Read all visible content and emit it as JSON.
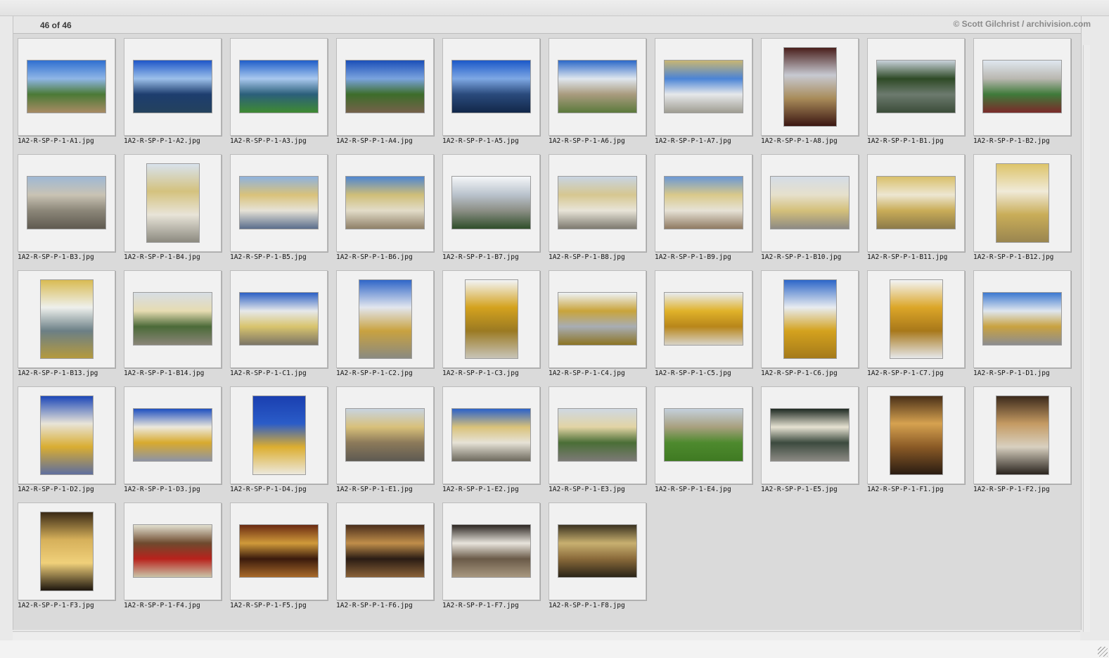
{
  "header": {
    "count_text": "46 of 46",
    "credit_text": "© Scott Gilchrist / archivision.com"
  },
  "thumbnails": [
    {
      "filename": "1A2-R-SP-P-1-A1.jpg",
      "orientation": "landscape",
      "colors": [
        "#2f6fd0",
        "#8fb6e6",
        "#4b7a36",
        "#a88a64"
      ]
    },
    {
      "filename": "1A2-R-SP-P-1-A2.jpg",
      "orientation": "landscape",
      "colors": [
        "#1e56c8",
        "#9cc0ea",
        "#1d3d6e",
        "#24425e"
      ]
    },
    {
      "filename": "1A2-R-SP-P-1-A3.jpg",
      "orientation": "landscape",
      "colors": [
        "#1f5ec9",
        "#a9c8ee",
        "#2b5f7a",
        "#3f8a32"
      ]
    },
    {
      "filename": "1A2-R-SP-P-1-A4.jpg",
      "orientation": "landscape",
      "colors": [
        "#1b4fb8",
        "#7aa3de",
        "#3d6d2a",
        "#75614a"
      ]
    },
    {
      "filename": "1A2-R-SP-P-1-A5.jpg",
      "orientation": "landscape",
      "colors": [
        "#1b58c8",
        "#7ea8e4",
        "#2a4a7c",
        "#12284a"
      ]
    },
    {
      "filename": "1A2-R-SP-P-1-A6.jpg",
      "orientation": "landscape",
      "colors": [
        "#2c68c8",
        "#dfe6ee",
        "#a99b7e",
        "#5b7a3c"
      ]
    },
    {
      "filename": "1A2-R-SP-P-1-A7.jpg",
      "orientation": "landscape",
      "colors": [
        "#c9b673",
        "#4b84d6",
        "#e6e8ea",
        "#9f9d92"
      ]
    },
    {
      "filename": "1A2-R-SP-P-1-A8.jpg",
      "orientation": "portrait",
      "colors": [
        "#4a1f1c",
        "#c7c9d1",
        "#a88b59",
        "#3b1612"
      ]
    },
    {
      "filename": "1A2-R-SP-P-1-B1.jpg",
      "orientation": "landscape",
      "colors": [
        "#c8d2da",
        "#2e4a26",
        "#6c7a6e",
        "#3c4d3a"
      ]
    },
    {
      "filename": "1A2-R-SP-P-1-B2.jpg",
      "orientation": "landscape",
      "colors": [
        "#dfe7ef",
        "#b9b7b0",
        "#3f7a3a",
        "#7b2a2a"
      ]
    },
    {
      "filename": "1A2-R-SP-P-1-B3.jpg",
      "orientation": "landscape",
      "colors": [
        "#9fb8d4",
        "#c9c3b4",
        "#8c8779",
        "#5f5a50"
      ]
    },
    {
      "filename": "1A2-R-SP-P-1-B4.jpg",
      "orientation": "portrait",
      "colors": [
        "#d8e2ec",
        "#d4c27e",
        "#e8e4d8",
        "#8c8a80"
      ]
    },
    {
      "filename": "1A2-R-SP-P-1-B5.jpg",
      "orientation": "landscape",
      "colors": [
        "#8fb2de",
        "#d9c27a",
        "#e6e2d6",
        "#5a6e8c"
      ]
    },
    {
      "filename": "1A2-R-SP-P-1-B6.jpg",
      "orientation": "landscape",
      "colors": [
        "#4f86d0",
        "#cfbe78",
        "#e2dcc8",
        "#8f8068"
      ]
    },
    {
      "filename": "1A2-R-SP-P-1-B7.jpg",
      "orientation": "landscape",
      "colors": [
        "#f4f6f8",
        "#b9c2cc",
        "#8c8f86",
        "#2f4e2a"
      ]
    },
    {
      "filename": "1A2-R-SP-P-1-B8.jpg",
      "orientation": "landscape",
      "colors": [
        "#c8d4e2",
        "#d6c790",
        "#e8e4d8",
        "#7d7a70"
      ]
    },
    {
      "filename": "1A2-R-SP-P-1-B9.jpg",
      "orientation": "landscape",
      "colors": [
        "#6b98d4",
        "#d9c98a",
        "#e6e2d6",
        "#8f7a62"
      ]
    },
    {
      "filename": "1A2-R-SP-P-1-B10.jpg",
      "orientation": "landscape",
      "colors": [
        "#d4dce6",
        "#e6e0cc",
        "#d4c07a",
        "#8d8a84"
      ]
    },
    {
      "filename": "1A2-R-SP-P-1-B11.jpg",
      "orientation": "landscape",
      "colors": [
        "#d9c06a",
        "#ede6d2",
        "#c9ad58",
        "#8c7a4a"
      ]
    },
    {
      "filename": "1A2-R-SP-P-1-B12.jpg",
      "orientation": "portrait",
      "colors": [
        "#ddc46a",
        "#f0ead8",
        "#c9ad58",
        "#9a8650"
      ]
    },
    {
      "filename": "1A2-R-SP-P-1-B13.jpg",
      "orientation": "portrait",
      "colors": [
        "#d9bb52",
        "#eef0ec",
        "#6b7f86",
        "#b59a3e"
      ]
    },
    {
      "filename": "1A2-R-SP-P-1-B14.jpg",
      "orientation": "landscape",
      "colors": [
        "#d7dde4",
        "#e6dcb2",
        "#4b6a38",
        "#8a8578"
      ]
    },
    {
      "filename": "1A2-R-SP-P-1-C1.jpg",
      "orientation": "landscape",
      "colors": [
        "#2b5fc4",
        "#e6e8ea",
        "#d8c46e",
        "#7c7566"
      ]
    },
    {
      "filename": "1A2-R-SP-P-1-C2.jpg",
      "orientation": "portrait",
      "colors": [
        "#2f66c8",
        "#e2e6ee",
        "#c9a240",
        "#8a8a80"
      ]
    },
    {
      "filename": "1A2-R-SP-P-1-C3.jpg",
      "orientation": "portrait",
      "colors": [
        "#f2f4f6",
        "#d4a21e",
        "#9b7a22",
        "#c8c4b8"
      ]
    },
    {
      "filename": "1A2-R-SP-P-1-C4.jpg",
      "orientation": "landscape",
      "colors": [
        "#eef2f6",
        "#c9a43a",
        "#a8adb4",
        "#8c7424"
      ]
    },
    {
      "filename": "1A2-R-SP-P-1-C5.jpg",
      "orientation": "landscape",
      "colors": [
        "#e8ecf0",
        "#e0b22a",
        "#b8861a",
        "#d8d4c8"
      ]
    },
    {
      "filename": "1A2-R-SP-P-1-C6.jpg",
      "orientation": "portrait",
      "colors": [
        "#2c66c8",
        "#e8ecf0",
        "#d4a21e",
        "#a57a1a"
      ]
    },
    {
      "filename": "1A2-R-SP-P-1-C7.jpg",
      "orientation": "portrait",
      "colors": [
        "#f2f4f6",
        "#dca628",
        "#a8781a",
        "#e6e8ea"
      ]
    },
    {
      "filename": "1A2-R-SP-P-1-D1.jpg",
      "orientation": "landscape",
      "colors": [
        "#3c78d0",
        "#dfe6ee",
        "#c9a240",
        "#8c8d90"
      ]
    },
    {
      "filename": "1A2-R-SP-P-1-D2.jpg",
      "orientation": "portrait",
      "colors": [
        "#1c47b8",
        "#e8e4d8",
        "#d9ad32",
        "#5e6e9e"
      ]
    },
    {
      "filename": "1A2-R-SP-P-1-D3.jpg",
      "orientation": "landscape",
      "colors": [
        "#1e4fc0",
        "#ece8dc",
        "#d8aa2e",
        "#8e94a4"
      ]
    },
    {
      "filename": "1A2-R-SP-P-1-D4.jpg",
      "orientation": "portrait",
      "colors": [
        "#1a3fb0",
        "#2a5cc8",
        "#dcae30",
        "#ece8dc"
      ]
    },
    {
      "filename": "1A2-R-SP-P-1-E1.jpg",
      "orientation": "landscape",
      "colors": [
        "#c8d4e0",
        "#d8c07a",
        "#8c7a5a",
        "#5e5a52"
      ]
    },
    {
      "filename": "1A2-R-SP-P-1-E2.jpg",
      "orientation": "landscape",
      "colors": [
        "#2c62c8",
        "#d9c27a",
        "#e6e2d6",
        "#6e6a5e"
      ]
    },
    {
      "filename": "1A2-R-SP-P-1-E3.jpg",
      "orientation": "landscape",
      "colors": [
        "#cfd8e2",
        "#e2d4a4",
        "#4a6e36",
        "#7c7a76"
      ]
    },
    {
      "filename": "1A2-R-SP-P-1-E4.jpg",
      "orientation": "landscape",
      "colors": [
        "#c4d0dc",
        "#a8a07e",
        "#4e8a2e",
        "#3f7a22"
      ]
    },
    {
      "filename": "1A2-R-SP-P-1-E5.jpg",
      "orientation": "landscape",
      "colors": [
        "#1e2a22",
        "#e6e2d2",
        "#3c4a3e",
        "#8c8a84"
      ]
    },
    {
      "filename": "1A2-R-SP-P-1-F1.jpg",
      "orientation": "portrait",
      "colors": [
        "#4a3018",
        "#d6a250",
        "#8a5a26",
        "#2a1c12"
      ]
    },
    {
      "filename": "1A2-R-SP-P-1-F2.jpg",
      "orientation": "portrait",
      "colors": [
        "#3c2a1c",
        "#c49a62",
        "#d8d0c0",
        "#2a241e"
      ]
    },
    {
      "filename": "1A2-R-SP-P-1-F3.jpg",
      "orientation": "portrait",
      "colors": [
        "#3a2a16",
        "#d6b05a",
        "#f0d07a",
        "#1e160e"
      ]
    },
    {
      "filename": "1A2-R-SP-P-1-F4.jpg",
      "orientation": "landscape",
      "colors": [
        "#e2e0d0",
        "#6e4a2e",
        "#b8221c",
        "#c9c4a8"
      ]
    },
    {
      "filename": "1A2-R-SP-P-1-F5.jpg",
      "orientation": "landscape",
      "colors": [
        "#6a2a12",
        "#d09a3a",
        "#3a1a0c",
        "#a86a2a"
      ]
    },
    {
      "filename": "1A2-R-SP-P-1-F6.jpg",
      "orientation": "landscape",
      "colors": [
        "#4a2e1c",
        "#c08e4a",
        "#2a1c14",
        "#8a6238"
      ]
    },
    {
      "filename": "1A2-R-SP-P-1-F7.jpg",
      "orientation": "landscape",
      "colors": [
        "#2c2622",
        "#e8e4dc",
        "#6a5a48",
        "#a89880"
      ]
    },
    {
      "filename": "1A2-R-SP-P-1-F8.jpg",
      "orientation": "landscape",
      "colors": [
        "#3a3220",
        "#c8b070",
        "#8a6a3a",
        "#2a2418"
      ]
    }
  ]
}
